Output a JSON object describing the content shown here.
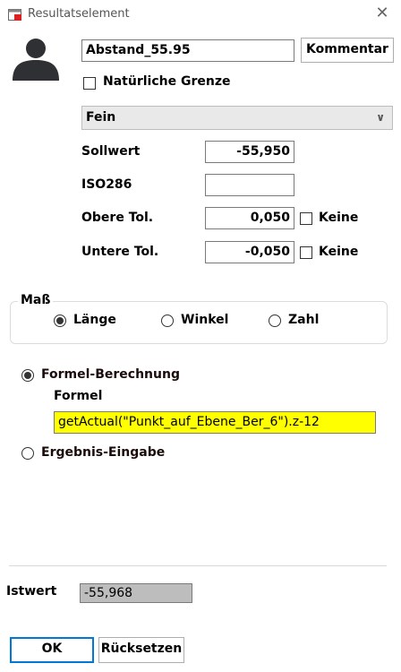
{
  "window": {
    "title": "Resultatselement"
  },
  "name_field": {
    "value": "Abstand_55.95"
  },
  "buttons": {
    "comment": "Kommentar",
    "ok": "OK",
    "reset": "Rücksetzen"
  },
  "natural_border": {
    "label": "Natürliche Grenze",
    "checked": false
  },
  "resolution": {
    "selected": "Fein"
  },
  "fields": {
    "nominal": {
      "label": "Sollwert",
      "value": "-55,950"
    },
    "iso": {
      "label": "ISO286",
      "value": ""
    },
    "upper": {
      "label": "Obere Tol.",
      "value": "0,050",
      "none_label": "Keine"
    },
    "lower": {
      "label": "Untere Tol.",
      "value": "-0,050",
      "none_label": "Keine"
    }
  },
  "measure": {
    "group_label": "Maß",
    "options": [
      {
        "label": "Länge",
        "selected": true
      },
      {
        "label": "Winkel",
        "selected": false
      },
      {
        "label": "Zahl",
        "selected": false
      }
    ]
  },
  "calc": {
    "formula_option": "Formel-Berechnung",
    "formula_label": "Formel",
    "formula_value": "getActual(\"Punkt_auf_Ebene_Ber_6\").z-12",
    "result_option": "Ergebnis-Eingabe"
  },
  "actual": {
    "label": "Istwert",
    "value": "-55,968"
  },
  "colors": {
    "formula_bg": "#ffff00",
    "actual_bg": "#bdbdbd",
    "default_button": "#0078d7"
  }
}
